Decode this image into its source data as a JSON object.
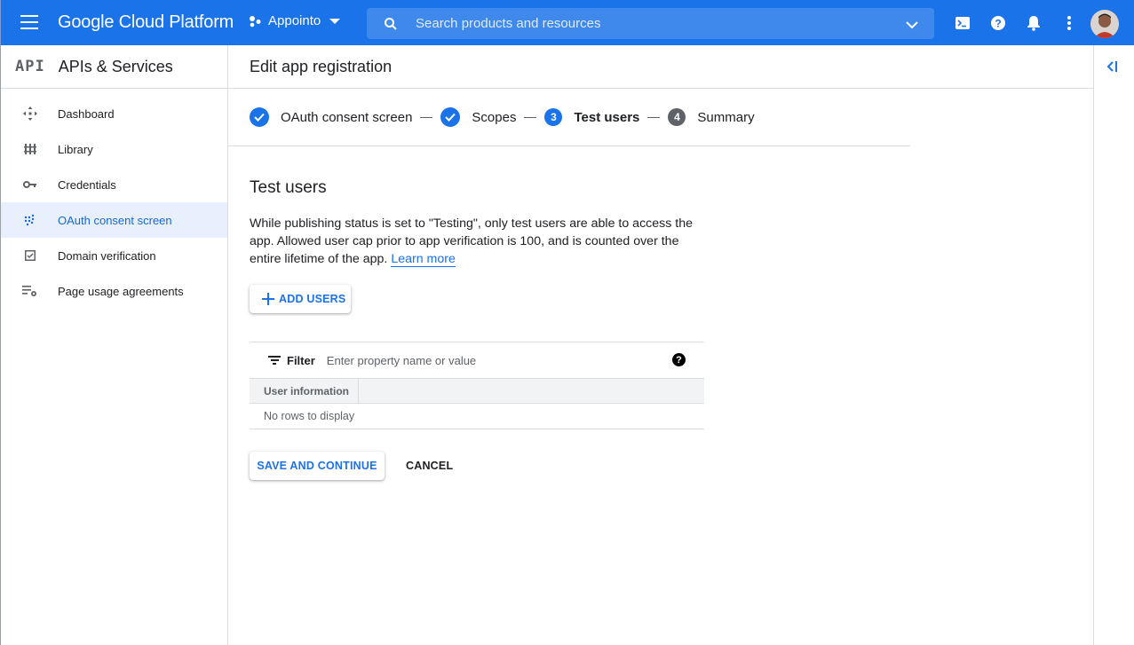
{
  "topbar": {
    "brand": "Google Cloud Platform",
    "project": "Appointo",
    "search_placeholder": "Search products and resources",
    "accent": "#1a73e8"
  },
  "sidebar": {
    "badge": "API",
    "title": "APIs & Services",
    "items": [
      {
        "label": "Dashboard",
        "icon": "dashboard-icon"
      },
      {
        "label": "Library",
        "icon": "library-icon"
      },
      {
        "label": "Credentials",
        "icon": "key-icon"
      },
      {
        "label": "OAuth consent screen",
        "icon": "consent-icon",
        "active": true
      },
      {
        "label": "Domain verification",
        "icon": "checkbox-icon"
      },
      {
        "label": "Page usage agreements",
        "icon": "settings-list-icon"
      }
    ]
  },
  "main": {
    "title": "Edit app registration",
    "steps": [
      {
        "label": "OAuth consent screen",
        "state": "done"
      },
      {
        "label": "Scopes",
        "state": "done"
      },
      {
        "number": "3",
        "label": "Test users",
        "state": "current"
      },
      {
        "number": "4",
        "label": "Summary",
        "state": "todo"
      }
    ],
    "section_title": "Test users",
    "description": "While publishing status is set to \"Testing\", only test users are able to access the app. Allowed user cap prior to app verification is 100, and is counted over the entire lifetime of the app.",
    "learn_more": "Learn more",
    "add_users": "ADD USERS",
    "table": {
      "filter_label": "Filter",
      "filter_placeholder": "Enter property name or value",
      "help": "?",
      "columns": [
        "User information"
      ],
      "empty": "No rows to display"
    },
    "save_button": "SAVE AND CONTINUE",
    "cancel_button": "CANCEL"
  }
}
